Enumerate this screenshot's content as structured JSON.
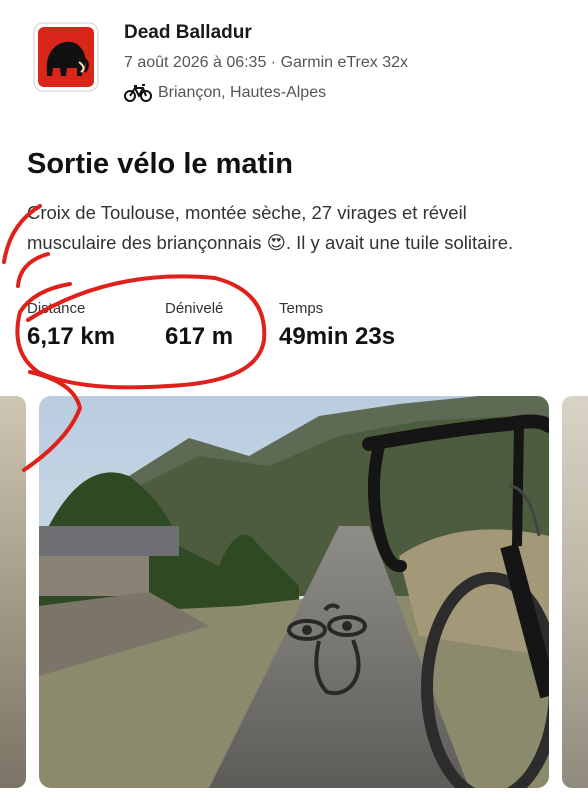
{
  "post": {
    "user_name": "Dead Balladur",
    "meta": "7 août 2026 à 06:35 · Garmin eTrex 32x",
    "location": "Briançon, Hautes-Alpes",
    "title": "Sortie vélo le matin",
    "description": "Croix de Toulouse, montée sèche, 27 virages et réveil musculaire des briançonnais 😍. Il y avait une tuile solitaire."
  },
  "stats": [
    {
      "label": "Distance",
      "value": "6,17 km"
    },
    {
      "label": "Dénivelé",
      "value": "617 m"
    },
    {
      "label": "Temps",
      "value": "49min 23s"
    }
  ],
  "icons": {
    "avatar": "mammoth-logo-icon",
    "activity": "bike-icon"
  },
  "colors": {
    "avatar_bg": "#d8261b",
    "annotation": "#e0201a"
  }
}
